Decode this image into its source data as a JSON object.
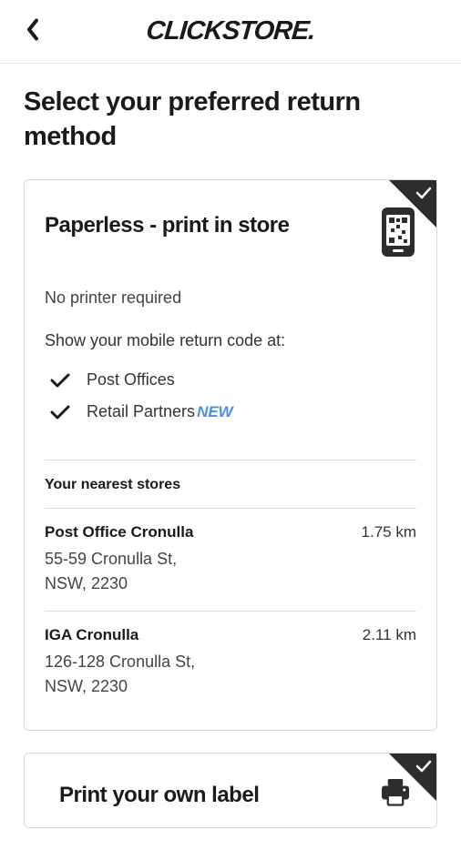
{
  "header": {
    "logo": "CLICKSTORE."
  },
  "page": {
    "title": "Select your preferred return method"
  },
  "card_paperless": {
    "title": "Paperless - print in store",
    "subtitle": "No printer required",
    "instruction": "Show your mobile return code at:",
    "options": [
      {
        "label": "Post Offices",
        "badge": ""
      },
      {
        "label": "Retail Partners",
        "badge": "NEW"
      }
    ],
    "stores_heading": "Your nearest stores",
    "stores": [
      {
        "name": "Post Office Cronulla",
        "address_line1": "55-59 Cronulla St,",
        "address_line2": "NSW, 2230",
        "distance": "1.75 km"
      },
      {
        "name": "IGA Cronulla",
        "address_line1": "126-128 Cronulla St,",
        "address_line2": "NSW, 2230",
        "distance": "2.11 km"
      }
    ]
  },
  "card_print": {
    "title": "Print your own label"
  }
}
